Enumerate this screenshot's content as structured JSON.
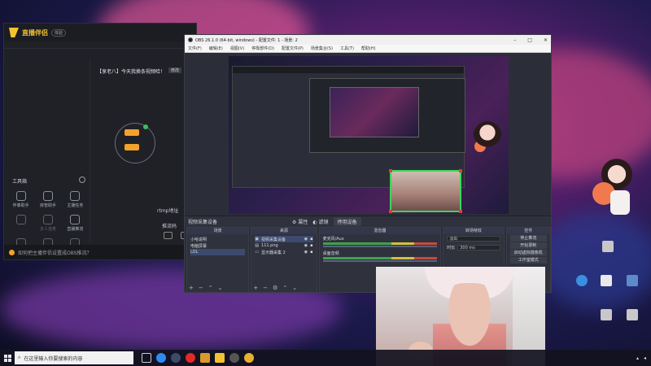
{
  "helper": {
    "app_name": "直播伴侣",
    "badge": "体验",
    "tabs": [
      "",
      "",
      ""
    ],
    "empty_note": "",
    "toolbox": {
      "title": "工具箱"
    },
    "tools": [
      {
        "label": "伴奏助手",
        "dim": false
      },
      {
        "label": "房管助手",
        "dim": false
      },
      {
        "label": "主播任务",
        "dim": false
      },
      {
        "label": "",
        "dim": true
      },
      {
        "label": "多人连麦",
        "dim": true
      },
      {
        "label": "直播推流",
        "dim": false
      },
      {
        "label": "",
        "dim": true
      },
      {
        "label": "",
        "dim": true
      },
      {
        "label": "",
        "dim": true
      }
    ],
    "room_title": "【享老八】今天我换条视频哈！",
    "room_title_btn": "修改",
    "room_meta": [
      "",
      ""
    ],
    "chip_top": "",
    "chip_bottom": "",
    "ring_label": "",
    "rtmp_label": "rtmp地址",
    "key_label": "推流码",
    "bottom_icons": [
      "",
      ""
    ],
    "status_text": "如何把主播伴侣设置成OBS推流？"
  },
  "obs": {
    "title": "OBS 26.1.0 (64-bit, windows) - 配置文件: 1 - 场景: 2",
    "menu": [
      "文件(F)",
      "编辑(E)",
      "视图(V)",
      "停靠部件(D)",
      "配置文件(P)",
      "场景集合(S)",
      "工具(T)",
      "帮助(H)"
    ],
    "source_bar": {
      "label": "视频采集设备",
      "properties": "属性",
      "filters": "滤镜",
      "activate": "停用设备"
    },
    "scenes_header": "场景",
    "scenes": [
      {
        "name": "小哈说明",
        "selected": false
      },
      {
        "name": "电脑屏幕",
        "selected": false
      },
      {
        "name": "LOL",
        "selected": true
      }
    ],
    "sources_header": "来源",
    "sources": [
      {
        "name": "视频采集设备",
        "selected": true
      },
      {
        "name": "111.png",
        "selected": false
      },
      {
        "name": "显示器采集 2",
        "selected": false
      }
    ],
    "mixer_header": "混音器",
    "mixer_rows": [
      "麦克风/Aux",
      "桌面音频"
    ],
    "transitions_header": "转场特效",
    "transition_value": "淡出",
    "duration_label": "时长",
    "duration_value": "300 ms",
    "controls_header": "控件",
    "controls": [
      "停止推流",
      "开始录制",
      "启动虚拟摄像机",
      "工作室模式"
    ]
  },
  "desktop_icons": [
    {
      "label": "",
      "color": "#3a8fe0"
    },
    {
      "label": "",
      "color": "#e9e9e9"
    },
    {
      "label": "",
      "color": "#5f8ac9"
    },
    {
      "label": "",
      "color": "#c7c7c7"
    },
    {
      "label": "",
      "color": "#c8c8c8"
    }
  ],
  "taskbar": {
    "search_placeholder": "在这里输入你要搜索的内容",
    "icons": [
      {
        "name": "edge-icon",
        "color": "#2d8cf0"
      },
      {
        "name": "steam-icon",
        "color": "#1b2838"
      },
      {
        "name": "netease-music-icon",
        "color": "#e02b2b"
      },
      {
        "name": "game-icon",
        "color": "#d99a2b"
      },
      {
        "name": "live-helper-icon",
        "color": "#f2c230"
      },
      {
        "name": "obs-icon",
        "color": "#555555"
      },
      {
        "name": "app-icon",
        "color": "#e9b02e"
      }
    ]
  }
}
